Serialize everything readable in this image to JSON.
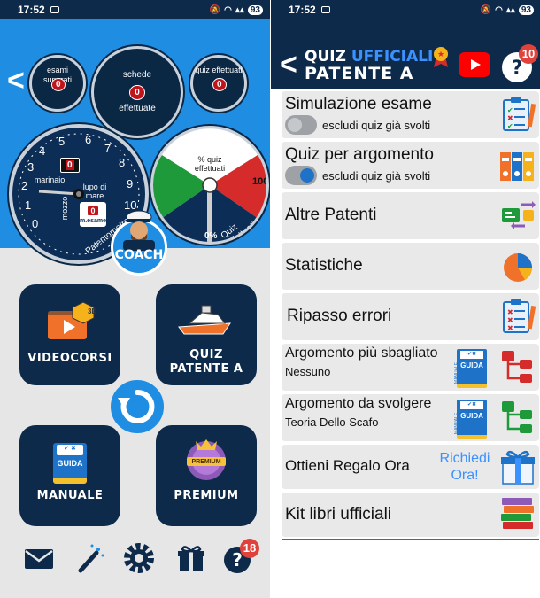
{
  "status_bar": {
    "time": "17:52",
    "battery": "93"
  },
  "left": {
    "gauges": {
      "exams": {
        "label": "esami superati",
        "value": "0"
      },
      "sheets": {
        "label_top": "schede",
        "label_bottom": "effettuate",
        "value": "0"
      },
      "quiz": {
        "label": "quiz effettuati",
        "value": "0"
      }
    },
    "patentometro": {
      "numbers": [
        "0",
        "1",
        "2",
        "3",
        "4",
        "5",
        "6",
        "7",
        "8",
        "9",
        "10"
      ],
      "value": "0",
      "rank_top": "marinaio",
      "rank_left": "mozzo",
      "rank_right": "lupo di mare",
      "exam_value": "0",
      "exam_label": "m.esame",
      "arc_label": "Patentometro"
    },
    "quiz_dial": {
      "label": "% quiz effettuati",
      "max": "100",
      "min": "0%",
      "arc_label": "Quiz effettuati"
    },
    "coach_label": "COACH",
    "tiles": {
      "videocorsi": "VIDEOCORSI",
      "quiz_line1": "QUIZ",
      "quiz_line2": "PATENTE A",
      "manuale": "MANUALE",
      "premium": "PREMIUM",
      "guida": "GUIDA",
      "badge_3d": "3D",
      "premium_badge": "PREMIUM"
    },
    "help_badge": "18"
  },
  "right": {
    "title_line1_a": "QUIZ",
    "title_line1_b": "UFFICIALI",
    "title_line2": "PATENTE A",
    "help_badge": "10",
    "items": [
      {
        "title": "Simulazione esame",
        "sub": "escludi quiz già svolti"
      },
      {
        "title": "Quiz per argomento",
        "sub": "escludi quiz già svolti"
      },
      {
        "title": "Altre Patenti"
      },
      {
        "title": "Statistiche"
      },
      {
        "title": "Ripasso errori"
      },
      {
        "title": "Argomento più sbagliato",
        "sub": "Nessuno",
        "book": "GUIDA",
        "book_side": "MANUALE"
      },
      {
        "title": "Argomento da svolgere",
        "sub": "Teoria Dello Scafo",
        "book": "GUIDA",
        "book_side": "MANUALE"
      },
      {
        "title": "Ottieni Regalo Ora",
        "cta_line1": "Richiedi",
        "cta_line2": "Ora!"
      },
      {
        "title": "Kit libri ufficiali"
      }
    ]
  },
  "colors": {
    "navy": "#0d2a4a",
    "blue": "#1e8de2",
    "link": "#3b92ff",
    "red": "#c0141a"
  }
}
